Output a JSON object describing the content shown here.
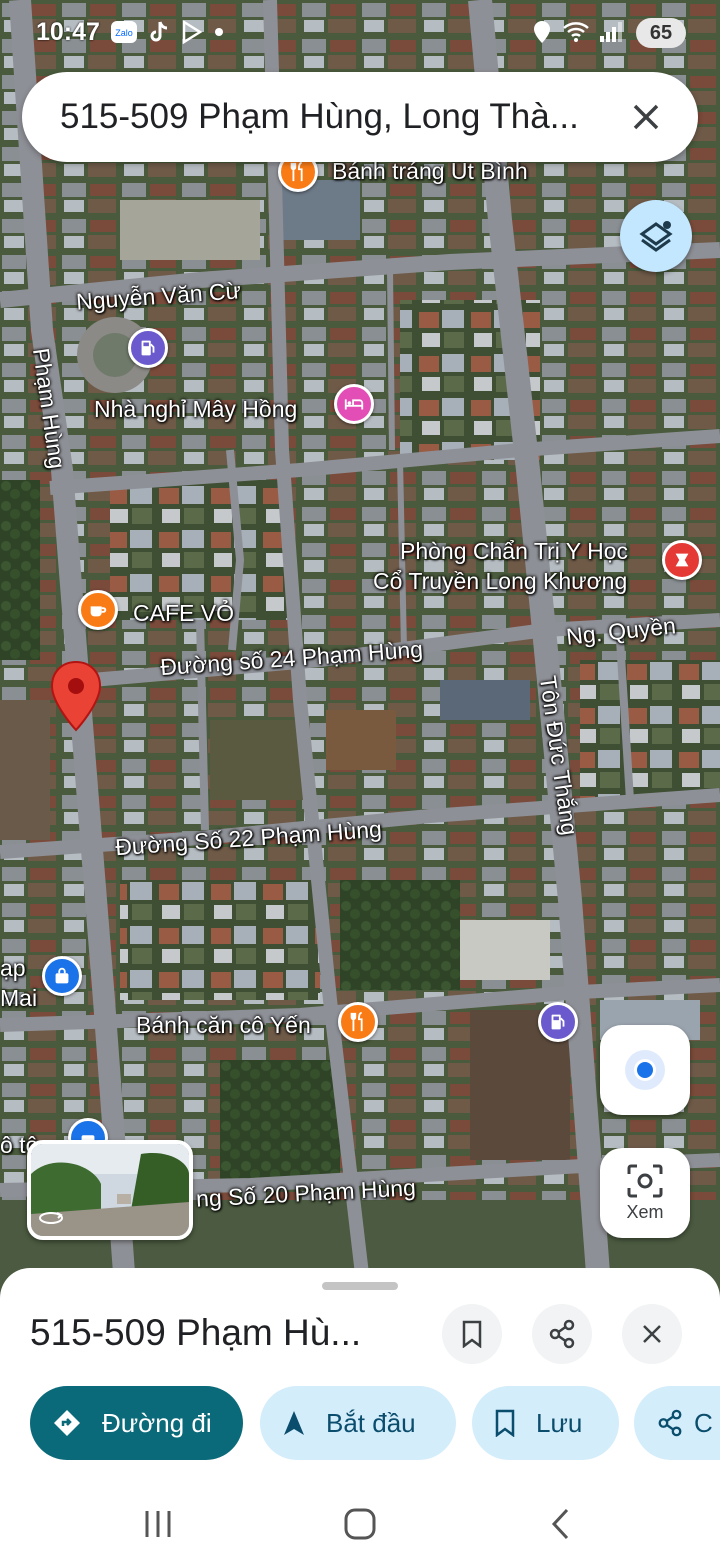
{
  "status_bar": {
    "time": "10:47",
    "app_icons": [
      "zalo-icon",
      "tiktok-icon",
      "play-icon",
      "dot-icon"
    ],
    "status_icons": [
      "location-icon",
      "wifi-icon",
      "signal-icon"
    ],
    "zalo_label": "Zalo",
    "battery": "65"
  },
  "search": {
    "text": "515-509 Phạm Hùng, Long Thà..."
  },
  "map": {
    "labels": {
      "banh_trang": "Bánh tráng Út Bình",
      "nguyen_van_cu": "Nguyễn Văn Cừ",
      "pham_hung_vertical": "Phạm Hùng",
      "nha_nghi": "Nhà nghỉ Mây Hồng",
      "phong_chan_tri_line1": "Phòng Chẩn Trị Y Học",
      "phong_chan_tri_line2": "Cổ Truyền Long Khương",
      "cafe_vo": "CAFE VỎ",
      "ng_quyen": "Ng. Quyền",
      "duong_so_24": "Đường số 24 Phạm Hùng",
      "ton_duc_thang": "Tôn Đức Thắng",
      "duong_so_22": "Đường Số 22 Phạm Hùng",
      "tap_hoa_line1": "ạp",
      "tap_hoa_line2": "Mai",
      "banh_can": "Bánh căn cô Yến",
      "o_to": "ô tô",
      "duong_so_20": "ng Số 20 Phạm Hùng"
    },
    "pin_colors": {
      "food": "#f97b16",
      "fuel": "#6a5acd",
      "hotel": "#e24eb5",
      "medical": "#e53935",
      "shop": "#1a73e8",
      "selected": "#ea4335"
    }
  },
  "controls": {
    "view_label": "Xem"
  },
  "sheet": {
    "title": "515-509 Phạm Hù...",
    "chips": {
      "directions": "Đường đi",
      "start": "Bắt đầu",
      "save": "Lưu",
      "share": "C"
    }
  }
}
